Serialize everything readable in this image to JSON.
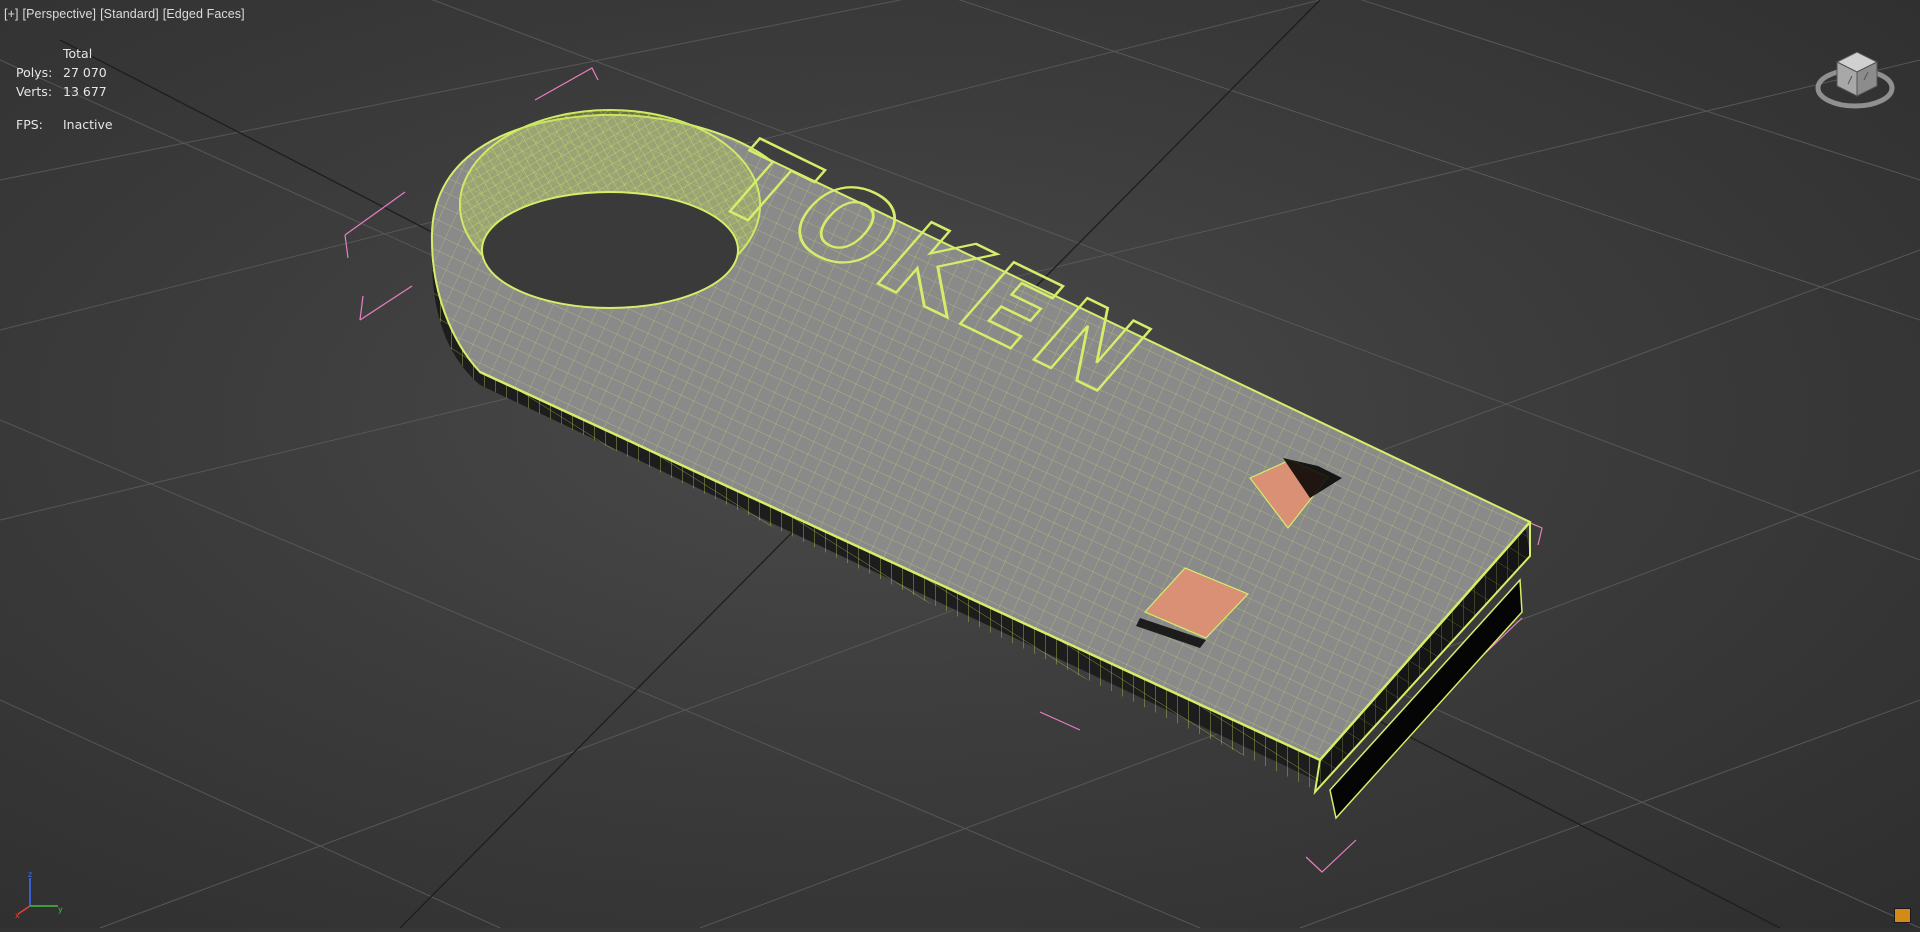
{
  "viewport": {
    "labels": [
      "[+]",
      "[Perspective]",
      "[Standard]",
      "[Edged Faces]"
    ]
  },
  "stats": {
    "header": "Total",
    "rows": [
      {
        "label": "Polys:",
        "value": "27 070"
      },
      {
        "label": "Verts:",
        "value": "13 677"
      }
    ],
    "fps_label": "FPS:",
    "fps_value": "Inactive"
  },
  "model": {
    "embossed_text": "TOKEN"
  },
  "colors": {
    "wireframe": "#d4ee6a",
    "surface": "#8a8a8a",
    "selection_bracket": "#e57fc0",
    "contact_pad": "#d99074",
    "grid_line": "#575757"
  },
  "icons": {
    "viewcube": "viewcube-icon",
    "axis": "axis-tripod-icon",
    "corner": "corner-button"
  }
}
